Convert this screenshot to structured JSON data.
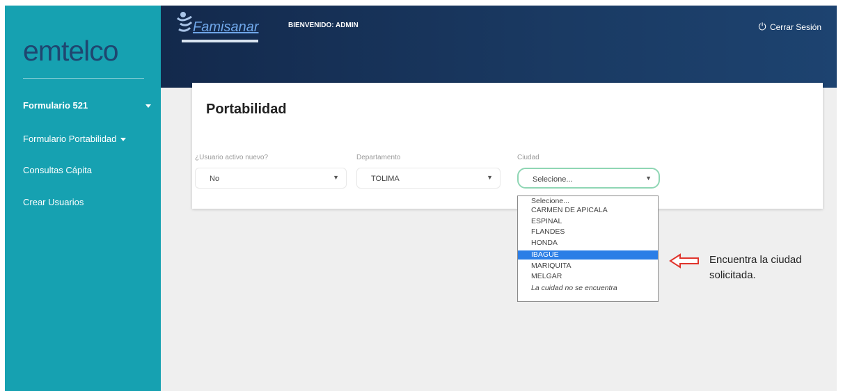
{
  "sidebar": {
    "logo": "emtelco",
    "items": [
      {
        "label": "Formulario 521"
      },
      {
        "label": "Formulario Portabilidad"
      },
      {
        "label": "Consultas Cápita"
      },
      {
        "label": "Crear Usuarios"
      }
    ]
  },
  "header": {
    "brand": "Famisanar",
    "welcome": "BIENVENIDO: ADMIN",
    "logout_label": "Cerrar Sesión"
  },
  "main": {
    "title": "Portabilidad",
    "fields": [
      {
        "label": "¿Usuario activo nuevo?",
        "value": "No"
      },
      {
        "label": "Departamento",
        "value": "TOLIMA"
      },
      {
        "label": "Ciudad",
        "value": "Selecione..."
      }
    ],
    "city_options": [
      "Selecione...",
      "CARMEN DE APICALA",
      "ESPINAL",
      "FLANDES",
      "HONDA",
      "IBAGUE",
      "MARIQUITA",
      "MELGAR",
      "La cuidad no se encuentra"
    ],
    "highlighted_option": "IBAGUE"
  },
  "annotation": {
    "line1": "Encuentra la ciudad",
    "line2": "solicitada."
  },
  "colors": {
    "sidebar": "#16a1b1",
    "header": "#13294c",
    "highlight": "#2b7ee6",
    "arrow": "#e0342c"
  }
}
